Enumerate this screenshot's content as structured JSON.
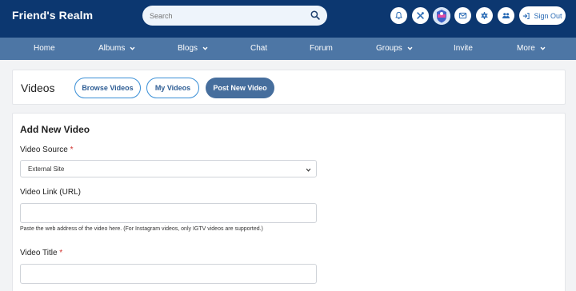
{
  "header": {
    "brand": "Friend's Realm",
    "search_placeholder": "Search",
    "sign_out_label": "Sign Out"
  },
  "nav": {
    "items": [
      {
        "label": "Home",
        "dropdown": false
      },
      {
        "label": "Albums",
        "dropdown": true
      },
      {
        "label": "Blogs",
        "dropdown": true
      },
      {
        "label": "Chat",
        "dropdown": false
      },
      {
        "label": "Forum",
        "dropdown": false
      },
      {
        "label": "Groups",
        "dropdown": true
      },
      {
        "label": "Invite",
        "dropdown": false
      },
      {
        "label": "More",
        "dropdown": true
      }
    ]
  },
  "videos_bar": {
    "title": "Videos",
    "browse_label": "Browse Videos",
    "my_label": "My Videos",
    "post_label": "Post New Video"
  },
  "form": {
    "title": "Add New Video",
    "source_label": "Video Source",
    "source_value": "External Site",
    "link_label": "Video Link (URL)",
    "link_value": "",
    "link_hint": "Paste the web address of the video here. (For Instagram videos, only IGTV videos are supported.)",
    "title_label": "Video Title",
    "title_value": "",
    "required_mark": "*"
  },
  "icons": {
    "notifications": "bell-icon",
    "tools": "tools-icon",
    "messages": "envelope-icon",
    "settings": "gear-icon",
    "friends": "users-icon",
    "search": "search-icon",
    "sign_out": "sign-out-icon"
  },
  "colors": {
    "header_bg": "#0c3770",
    "nav_bg": "#4d76a5",
    "accent": "#2a6bb5",
    "primary_button": "#466e9d",
    "required": "#d0312d"
  }
}
